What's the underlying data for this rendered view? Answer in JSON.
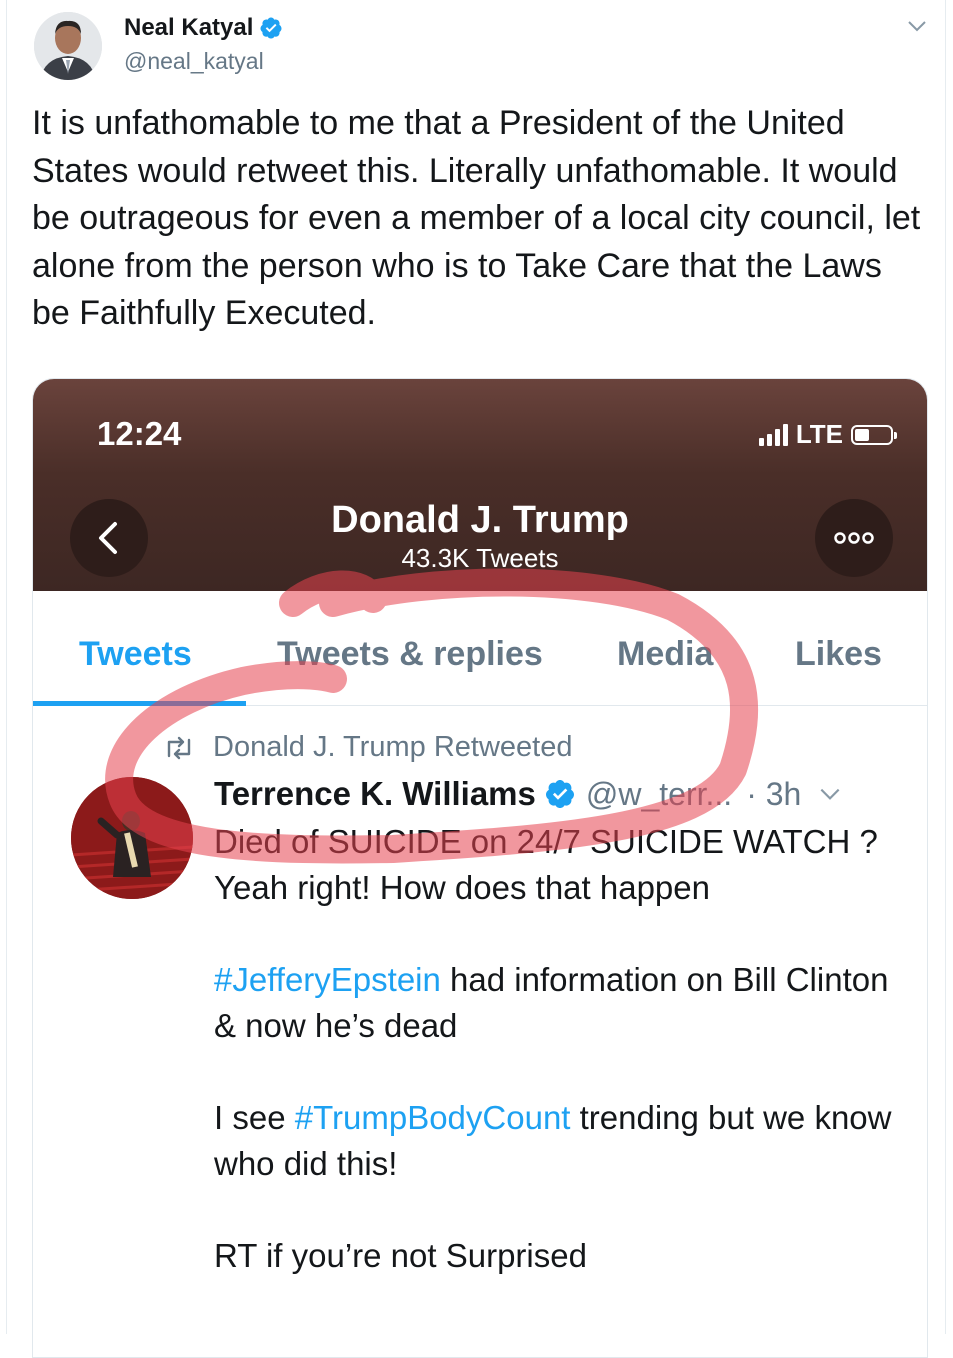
{
  "outer_tweet": {
    "author_name": "Neal Katyal",
    "author_handle": "@neal_katyal",
    "text": "It is unfathomable to me that a President of the United States would retweet this. Literally unfathomable. It would be outrageous for even a member of a local city council, let alone from the person who is to Take Care that the Laws be Faithfully Executed."
  },
  "embedded": {
    "status_bar": {
      "time": "12:24",
      "network": "LTE"
    },
    "profile": {
      "name": "Donald J. Trump",
      "tweet_count": "43.3K Tweets"
    },
    "tabs": [
      {
        "label": "Tweets",
        "active": true
      },
      {
        "label": "Tweets & replies",
        "active": false
      },
      {
        "label": "Media",
        "active": false
      },
      {
        "label": "Likes",
        "active": false
      }
    ],
    "retweet_label": "Donald J. Trump Retweeted",
    "inner_tweet": {
      "author_name": "Terrence K. Williams",
      "author_handle": "@w_terr...",
      "time": "· 3h",
      "para1": "Died of SUICIDE on 24/7 SUICIDE WATCH ? Yeah right! How does that happen",
      "para2_hashtag": "#JefferyEpstein",
      "para2_rest": " had information on Bill Clinton & now he’s dead",
      "para3_start": "I see ",
      "para3_hashtag": "#TrumpBodyCount",
      "para3_rest": " trending but we know who did this!",
      "para4": "RT if you’re not Surprised"
    }
  },
  "colors": {
    "accent": "#1da1f2",
    "secondary_text": "#657786",
    "annotation_red": "#e5414f",
    "header_brown": "#4a2e28"
  },
  "icons": [
    "verified-badge-icon",
    "chevron-down-icon",
    "back-arrow-icon",
    "more-options-icon",
    "retweet-icon",
    "signal-icon",
    "battery-icon"
  ]
}
